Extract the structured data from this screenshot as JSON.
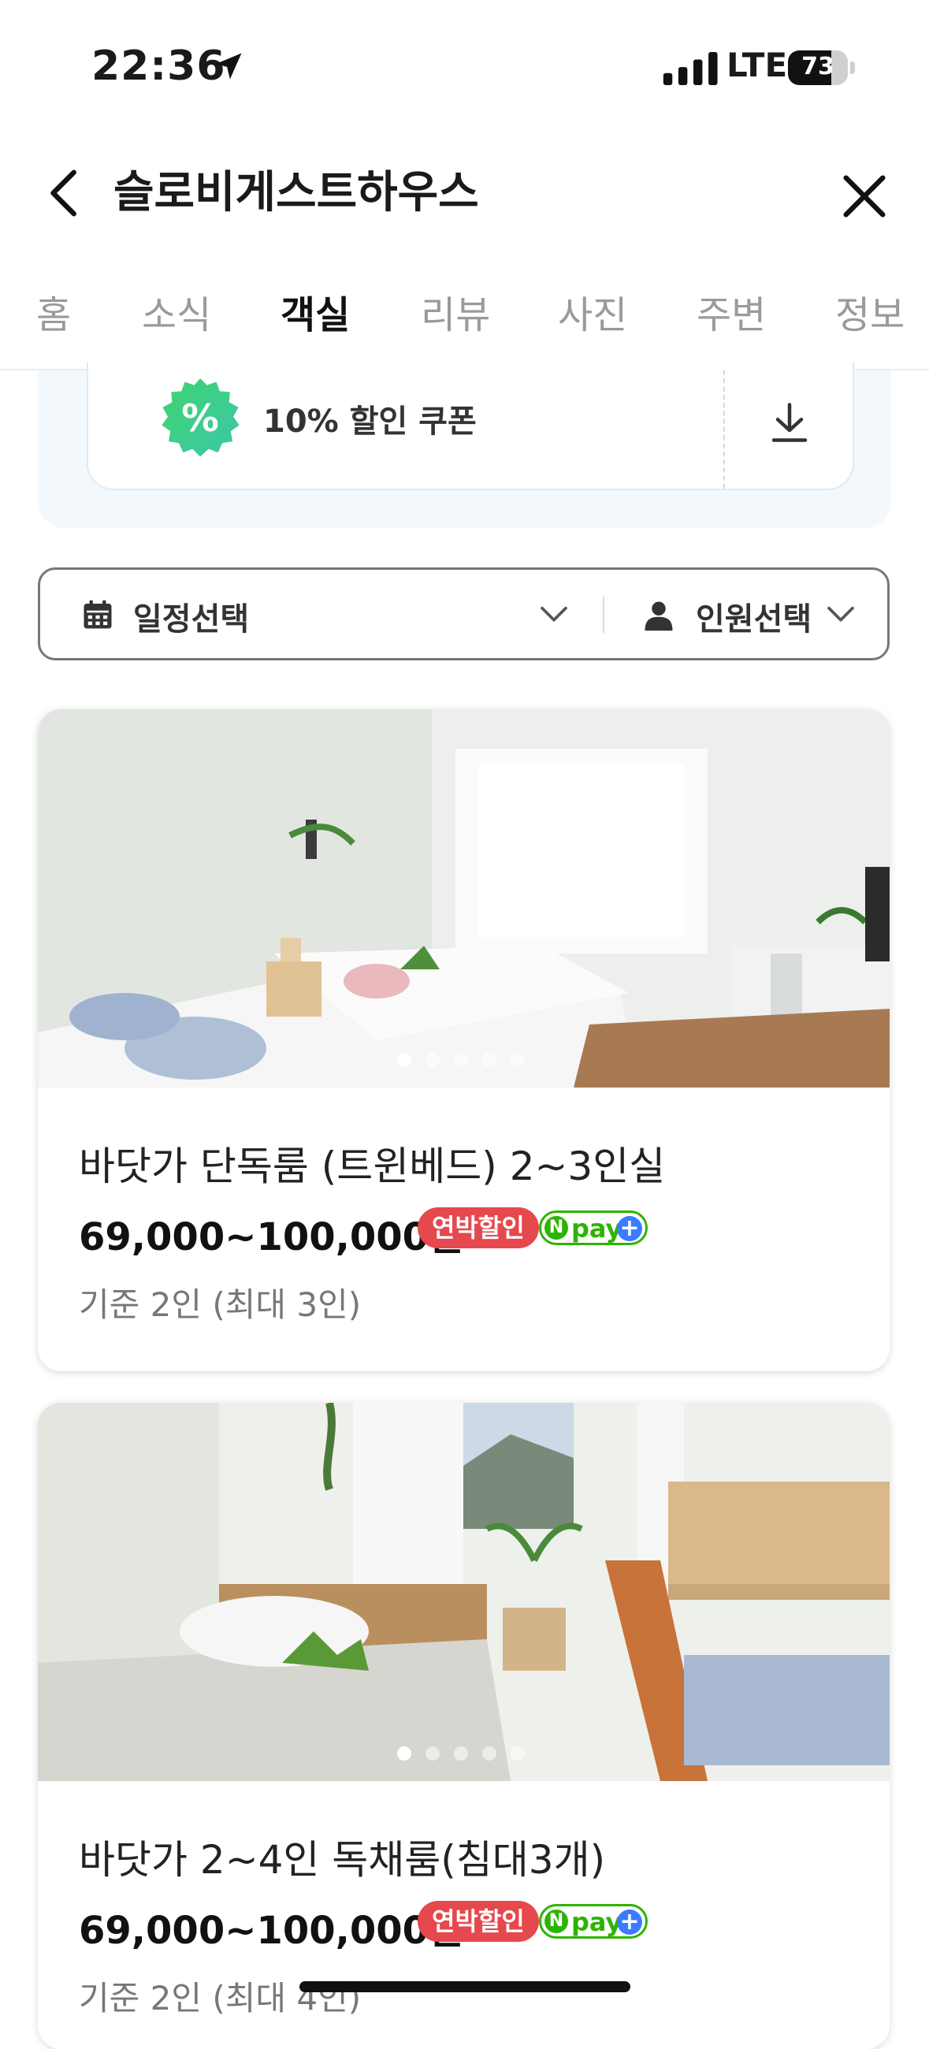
{
  "status_bar": {
    "time": "22:36",
    "network": "LTE",
    "battery": "73",
    "battery_level": 0.73
  },
  "header": {
    "title": "슬로비게스트하우스"
  },
  "tabs": [
    {
      "label": "홈"
    },
    {
      "label": "소식"
    },
    {
      "label": "객실",
      "active": true
    },
    {
      "label": "리뷰"
    },
    {
      "label": "사진"
    },
    {
      "label": "주변"
    },
    {
      "label": "정보"
    }
  ],
  "coupon": {
    "label": "10% 할인 쿠폰",
    "badge_symbol": "%"
  },
  "filter": {
    "date_label": "일정선택",
    "people_label": "인원선택"
  },
  "rooms": [
    {
      "name": "바닷가 단독룸 (트윈베드) 2~3인실",
      "price": "69,000~100,000원",
      "badge": "연박할인",
      "npay": "pay",
      "npay_n": "N",
      "npay_plus": "+",
      "capacity": "기준 2인 (최대 3인)",
      "photo_count": 5,
      "photo_index": 1
    },
    {
      "name": "바닷가 2~4인 독채룸(침대3개)",
      "price": "69,000~100,000원",
      "badge": "연박할인",
      "npay": "pay",
      "npay_n": "N",
      "npay_plus": "+",
      "capacity": "기준 2인 (최대 4인)",
      "photo_count": 5,
      "photo_index": 1
    }
  ],
  "colors": {
    "badge_red": "#e5484d",
    "npay_green": "#2db400",
    "coupon_bg": "#f2f8fc"
  }
}
